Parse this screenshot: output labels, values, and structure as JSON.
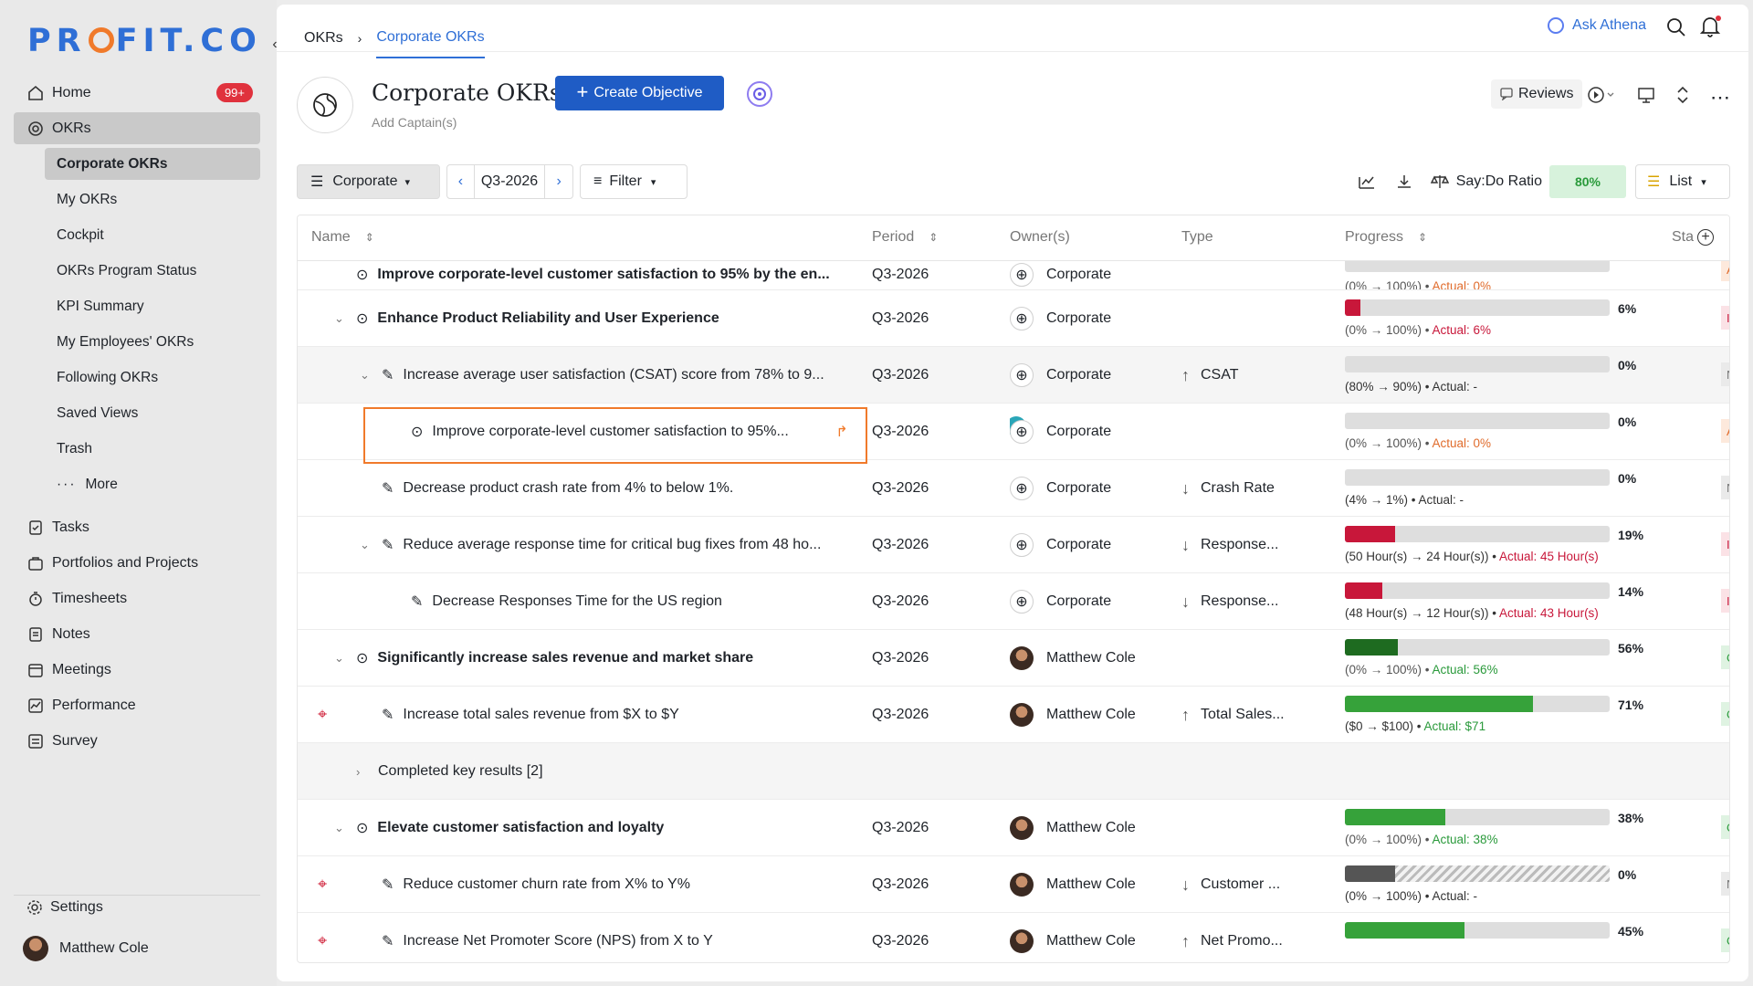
{
  "brand": {
    "name_left": "PR",
    "name_right": "FIT.CO"
  },
  "sidebar": {
    "items": [
      {
        "label": "Home",
        "badge": "99+"
      },
      {
        "label": "OKRs"
      }
    ],
    "okr_sub": [
      "Corporate OKRs",
      "My OKRs",
      "Cockpit",
      "OKRs Program Status",
      "KPI Summary",
      "My Employees' OKRs",
      "Following OKRs",
      "Saved Views",
      "Trash",
      "More"
    ],
    "more_items": [
      "Tasks",
      "Portfolios and Projects",
      "Timesheets",
      "Notes",
      "Meetings",
      "Performance",
      "Survey"
    ],
    "settings": "Settings",
    "user": "Matthew Cole"
  },
  "topbar": {
    "crumb_root": "OKRs",
    "crumb_current": "Corporate OKRs",
    "ask": "Ask Athena"
  },
  "header": {
    "title": "Corporate OKRs",
    "captain": "Add Captain(s)",
    "create": "Create Objective",
    "reviews": "Reviews"
  },
  "toolbar": {
    "view": "Corporate",
    "period": "Q3-2026",
    "filter": "Filter",
    "sayd_label": "Say:Do Ratio",
    "sayd_value": "80%",
    "layout": "List"
  },
  "columns": {
    "name": "Name",
    "period": "Period",
    "owner": "Owner(s)",
    "type": "Type",
    "progress": "Progress",
    "status": "Sta"
  },
  "rows": [
    {
      "name": "Improve corporate-level customer satisfaction to 95% by the en...",
      "period": "Q3-2026",
      "owner": "Corporate",
      "type": "",
      "progress_fill": 0,
      "range": "(0% → 100%)",
      "actual": "Actual: 0%",
      "pct": "",
      "status": "At Risk"
    },
    {
      "name": "Enhance Product Reliability and User Experience",
      "period": "Q3-2026",
      "owner": "Corporate",
      "type": "",
      "progress_fill": 6,
      "range": "(0% → 100%)",
      "actual": "Actual: 6%",
      "pct": "6%",
      "status": "In Trouble"
    },
    {
      "name": "Increase average user satisfaction (CSAT) score from 78% to 9...",
      "period": "Q3-2026",
      "owner": "Corporate",
      "type": "CSAT",
      "progress_fill": 0,
      "range": "(80% → 90%)",
      "actual": "Actual: -",
      "pct": "0%",
      "status": "Not Started"
    },
    {
      "name": "Improve corporate-level customer satisfaction to 95%...",
      "period": "Q3-2026",
      "owner": "Corporate",
      "type": "",
      "progress_fill": 0,
      "range": "(0% → 100%)",
      "actual": "Actual: 0%",
      "pct": "0%",
      "status": "At Risk"
    },
    {
      "name": "Decrease product crash rate from 4% to below 1%.",
      "period": "Q3-2026",
      "owner": "Corporate",
      "type": "Crash Rate",
      "progress_fill": 0,
      "range": "(4% → 1%)",
      "actual": "Actual: -",
      "pct": "0%",
      "status": "Not Started"
    },
    {
      "name": "Reduce average response time for critical bug fixes from 48 ho...",
      "period": "Q3-2026",
      "owner": "Corporate",
      "type": "Response...",
      "progress_fill": 19,
      "range": "(50 Hour(s) → 24 Hour(s))",
      "actual": "Actual: 45 Hour(s)",
      "pct": "19%",
      "status": "In Trouble"
    },
    {
      "name": "Decrease Responses Time for the US region",
      "period": "Q3-2026",
      "owner": "Corporate",
      "type": "Response...",
      "progress_fill": 14,
      "range": "(48 Hour(s) → 12 Hour(s))",
      "actual": "Actual: 43 Hour(s)",
      "pct": "14%",
      "status": "In Trouble"
    },
    {
      "name": "Significantly increase sales revenue and market share",
      "period": "Q3-2026",
      "owner": "Matthew Cole",
      "type": "",
      "progress_fill": 20,
      "range": "(0% → 100%)",
      "actual": "Actual: 56%",
      "pct": "56%",
      "status": "On Track"
    },
    {
      "name": "Increase total sales revenue from $X to $Y",
      "period": "Q3-2026",
      "owner": "Matthew Cole",
      "type": "Total Sales...",
      "progress_fill": 71,
      "range": "($0 → $100)",
      "actual": "Actual: $71",
      "pct": "71%",
      "status": "On Track"
    },
    {
      "name": "Completed key results [2]"
    },
    {
      "name": "Elevate customer satisfaction and loyalty",
      "period": "Q3-2026",
      "owner": "Matthew Cole",
      "type": "",
      "progress_fill": 38,
      "range": "(0% → 100%)",
      "actual": "Actual: 38%",
      "pct": "38%",
      "status": "On Track"
    },
    {
      "name": "Reduce customer churn rate from X% to Y%",
      "period": "Q3-2026",
      "owner": "Matthew Cole",
      "type": "Customer ...",
      "progress_fill": 0,
      "range": "(0% → 100%)",
      "actual": "Actual: -",
      "pct": "0%",
      "status": "Not Started"
    },
    {
      "name": "Increase Net Promoter Score (NPS) from X to Y",
      "period": "Q3-2026",
      "owner": "Matthew Cole",
      "type": "Net Promo...",
      "progress_fill": 45,
      "range": "",
      "actual": "",
      "pct": "45%",
      "status": "On Track"
    }
  ],
  "colors": {
    "accent": "#1f5cc5",
    "red": "#c8173a",
    "green": "#2a9a3b",
    "dark_green": "#1e6b20",
    "orange": "#e06b2b"
  }
}
